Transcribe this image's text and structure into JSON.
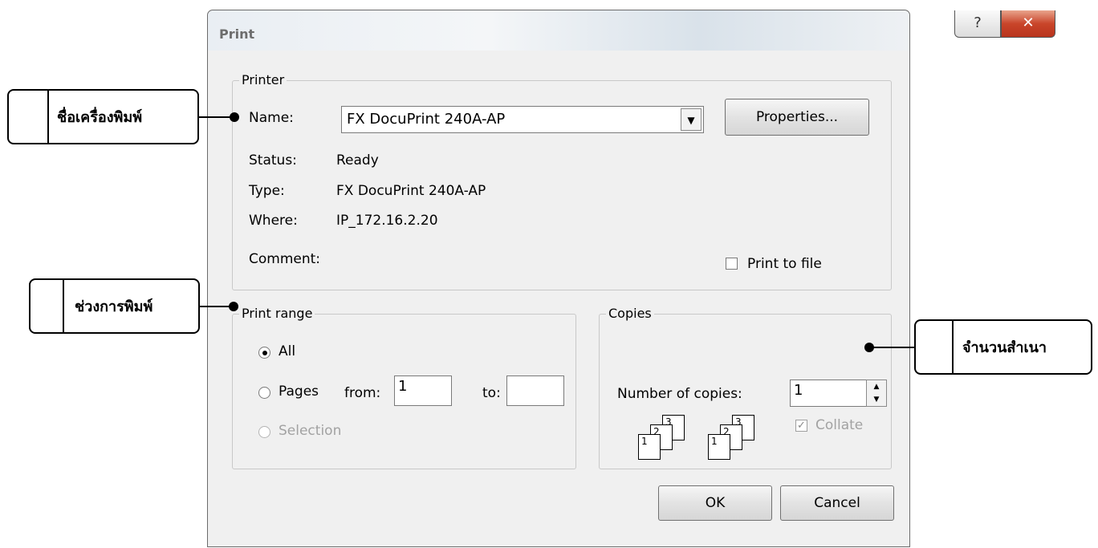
{
  "dialog": {
    "title": "Print",
    "help_label": "?",
    "close_label": "✕"
  },
  "printer": {
    "legend": "Printer",
    "name_label": "Name:",
    "name_value": "FX DocuPrint 240A-AP",
    "properties_label": "Properties...",
    "status_label": "Status:",
    "status_value": "Ready",
    "type_label": "Type:",
    "type_value": "FX DocuPrint 240A-AP",
    "where_label": "Where:",
    "where_value": "IP_172.16.2.20",
    "comment_label": "Comment:",
    "print_to_file_label": "Print to file",
    "print_to_file_checked": false
  },
  "print_range": {
    "legend": "Print range",
    "all_label": "All",
    "all_selected": true,
    "pages_label": "Pages",
    "from_label": "from:",
    "from_value": "1",
    "to_label": "to:",
    "to_value": "",
    "selection_label": "Selection"
  },
  "copies": {
    "legend": "Copies",
    "number_label": "Number of copies:",
    "number_value": "1",
    "collate_label": "Collate",
    "collate_checked": true,
    "collate_icon_pages": [
      "1",
      "2",
      "3"
    ]
  },
  "buttons": {
    "ok_label": "OK",
    "cancel_label": "Cancel"
  },
  "annotations": {
    "printer_name": "ชื่อเครื่องพิมพ์",
    "print_range": "ช่วงการพิมพ์",
    "copies": "จำนวนสำเนา"
  }
}
